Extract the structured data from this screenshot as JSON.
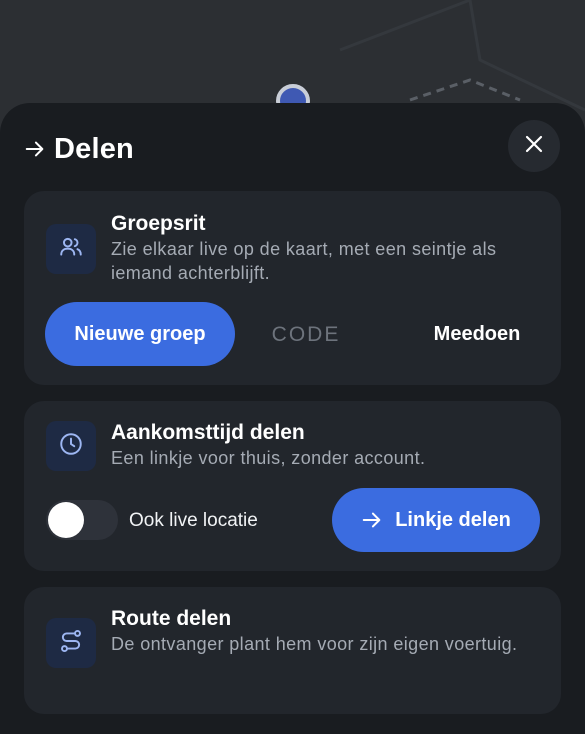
{
  "sheet": {
    "title": "Delen",
    "icons": {
      "title": "arrow-right-icon",
      "close": "close-icon"
    }
  },
  "group_ride": {
    "title": "Groepsrit",
    "description": "Zie elkaar live op de kaart, met een seintje als iemand achterblijft.",
    "icon": "users-icon",
    "new_group_label": "Nieuwe groep",
    "code_placeholder": "CODE",
    "code_value": "",
    "join_label": "Meedoen"
  },
  "arrival": {
    "title": "Aankomsttijd delen",
    "description": "Een linkje voor thuis, zonder account.",
    "icon": "clock-icon",
    "live_location_label": "Ook live locatie",
    "live_location_enabled": false,
    "share_button_label": "Linkje delen",
    "share_button_icon": "arrow-right-icon"
  },
  "route": {
    "title": "Route delen",
    "description": "De ontvanger plant hem voor zijn eigen voertuig.",
    "icon": "route-icon"
  },
  "colors": {
    "accent": "#3b6ce0",
    "sheet_bg": "#191c20",
    "card_bg": "#22262c",
    "icon_tile_bg": "#1e2a44",
    "muted_text": "#a5abb4"
  }
}
